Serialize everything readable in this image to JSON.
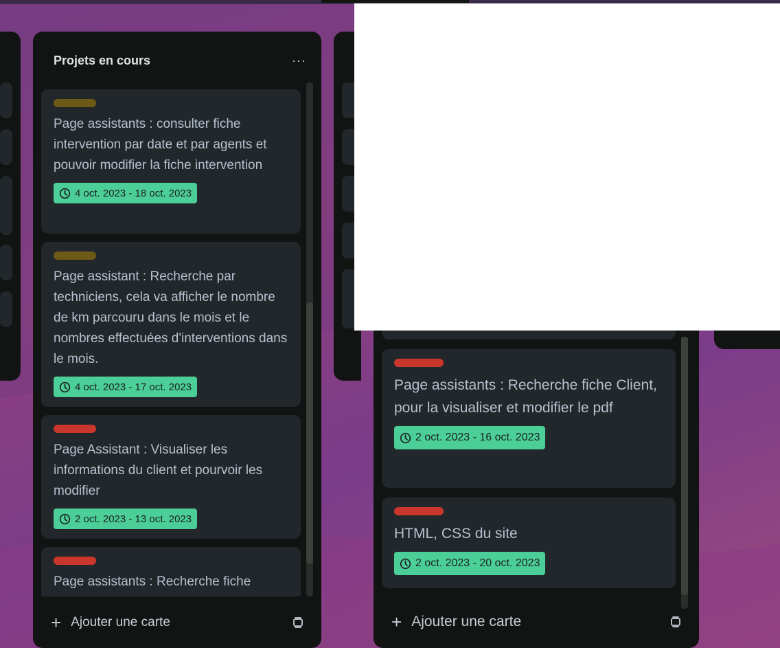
{
  "lists": [
    {
      "title": "Projets en cours",
      "menu": "···",
      "add_card": "Ajouter une carte",
      "cards": [
        {
          "label_color": "#6e5a17",
          "title": "Page assistants : consulter fiche intervention par date et par agents et pouvoir modifier la fiche intervention",
          "date": "4 oct. 2023 - 18 oct. 2023"
        },
        {
          "label_color": "#6e5a17",
          "title": "Page assistant : Recherche par techniciens, cela va afficher le nombre de km parcouru dans le mois et le nombres effectuées d'interventions dans le mois.",
          "date": "4 oct. 2023 - 17 oct. 2023"
        },
        {
          "label_color": "#c9372c",
          "title": "Page Assistant : Visualiser les informations du client et pourvoir les modifier",
          "date": "2 oct. 2023 - 13 oct. 2023"
        },
        {
          "label_color": "#c9372c",
          "title": "Page assistants : Recherche fiche Client, pour la visualiser et modifier le pdf",
          "date": ""
        }
      ]
    },
    {
      "add_card": "Ajouter une carte",
      "cards": [
        {
          "label_color": "#c9372c",
          "title": "Page assistants : Recherche fiche Client, pour la visualiser et modifier le pdf",
          "date": "2 oct. 2023 - 16 oct. 2023"
        },
        {
          "label_color": "#c9372c",
          "title": "HTML, CSS du site",
          "date": "2 oct. 2023 - 20 oct. 2023"
        }
      ]
    }
  ],
  "colors": {
    "list_bg": "#111412",
    "card_bg": "#22272b",
    "date_badge_bg": "#4bce97",
    "label_red": "#c9372c",
    "label_brown": "#6e5a17"
  }
}
